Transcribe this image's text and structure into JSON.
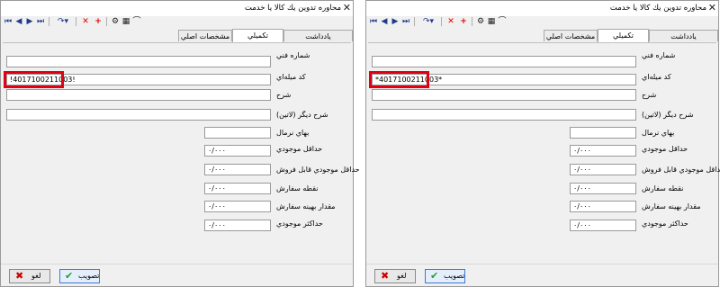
{
  "window": {
    "title": "محاوره تدوین یك كالا یا خدمت",
    "close_glyph": "✕"
  },
  "toolbar": {
    "first_icon": "first-record-icon",
    "prev_icon": "prev-record-icon",
    "next_icon": "next-record-icon",
    "last_icon": "last-record-icon",
    "refresh_icon": "refresh-icon",
    "delete_icon": "delete-icon",
    "add_icon": "add-icon",
    "tool1_icon": "settings-icon",
    "tool2_icon": "grid-icon",
    "tool3_icon": "binoculars-icon",
    "glyphs": {
      "first": "⏮",
      "prev": "◀",
      "next": "▶",
      "last": "⏭",
      "refresh": "↷▾",
      "delete": "✕",
      "add": "+",
      "tool1": "⚙",
      "tool2": "▦",
      "tool3": "⌒"
    }
  },
  "tabs": [
    {
      "label": "مشخصات اصلي",
      "active": false
    },
    {
      "label": "تكميلي",
      "active": true
    },
    {
      "label": "يادداشت",
      "active": false
    }
  ],
  "fields": {
    "technical_no": {
      "label": "شماره فني",
      "value": ""
    },
    "barcode": {
      "label": "كد ميله‌اي"
    },
    "description": {
      "label": "شرح",
      "value": ""
    },
    "latin_description": {
      "label": "شرح ديگر (لاتين)",
      "value": ""
    },
    "normal_price": {
      "label": "بهاي نرمال",
      "value": ""
    },
    "min_stock": {
      "label": "حداقل موجودي",
      "value": "۰/۰۰۰"
    },
    "min_sellable_stock": {
      "label": "حداقل موجودي قابل فروش",
      "value": "۰/۰۰۰"
    },
    "reorder_point": {
      "label": "نقطه سفارش",
      "value": "۰/۰۰۰"
    },
    "optimal_order_qty": {
      "label": "مقدار بهينه سفارش",
      "value": "۰/۰۰۰"
    },
    "max_stock": {
      "label": "حداكثر موجودي",
      "value": "۰/۰۰۰"
    }
  },
  "barcode_values": {
    "left": "!4017100211003!",
    "right": "*4017100211003*"
  },
  "buttons": {
    "approve_label": "تصويب",
    "cancel_label": "لغو",
    "approve_glyph": "✔",
    "cancel_glyph": "✖"
  },
  "colors": {
    "highlight": "#e00012",
    "approve_check": "#2e9a2e",
    "cancel_x": "#d00000"
  }
}
